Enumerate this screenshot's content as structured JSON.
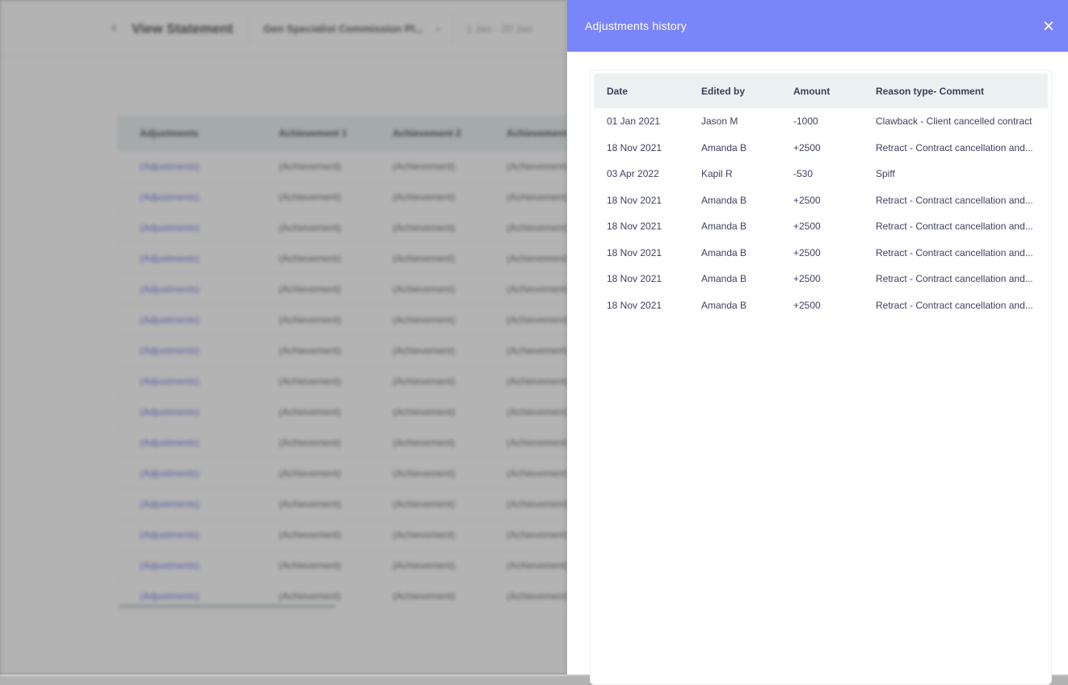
{
  "background_page": {
    "back_icon": "chevron-left-icon",
    "title": "View Statement",
    "plan_select": "Gen Specialist Commission Pl...",
    "plan_chevron_icon": "chevron-down-icon",
    "date_range": "1 Jan - 20 Jan",
    "table": {
      "columns": [
        "Adjustments",
        "Achievement 1",
        "Achievement 2",
        "Achievement"
      ],
      "rows": [
        [
          "(Adjustments)",
          "(Achievement)",
          "(Achievement)",
          "(Achievement)"
        ],
        [
          "(Adjustments)",
          "(Achievement)",
          "(Achievement)",
          "(Achievement)"
        ],
        [
          "(Adjustments)",
          "(Achievement)",
          "(Achievement)",
          "(Achievement)"
        ],
        [
          "(Adjustments)",
          "(Achievement)",
          "(Achievement)",
          "(Achievement)"
        ],
        [
          "(Adjustments)",
          "(Achievement)",
          "(Achievement)",
          "(Achievement)"
        ],
        [
          "(Adjustments)",
          "(Achievement)",
          "(Achievement)",
          "(Achievement)"
        ],
        [
          "(Adjustments)",
          "(Achievement)",
          "(Achievement)",
          "(Achievement)"
        ],
        [
          "(Adjustments)",
          "(Achievement)",
          "(Achievement)",
          "(Achievement)"
        ],
        [
          "(Adjustments)",
          "(Achievement)",
          "(Achievement)",
          "(Achievement)"
        ],
        [
          "(Adjustments)",
          "(Achievement)",
          "(Achievement)",
          "(Achievement)"
        ],
        [
          "(Adjustments)",
          "(Achievement)",
          "(Achievement)",
          "(Achievement)"
        ],
        [
          "(Adjustments)",
          "(Achievement)",
          "(Achievement)",
          "(Achievement)"
        ],
        [
          "(Adjustments)",
          "(Achievement)",
          "(Achievement)",
          "(Achievement)"
        ],
        [
          "(Adjustments)",
          "(Achievement)",
          "(Achievement)",
          "(Achievement)"
        ],
        [
          "(Adjustments)",
          "(Achievement)",
          "(Achievement)",
          "(Achievement)"
        ]
      ]
    }
  },
  "drawer": {
    "title": "Adjustments history",
    "close_icon": "close-icon",
    "header_color": "#7b85fa",
    "table": {
      "columns": {
        "date": "Date",
        "edited_by": "Edited by",
        "amount": "Amount",
        "reason": "Reason type- Comment"
      },
      "rows": [
        {
          "date": "01 Jan 2021",
          "edited_by": "Jason M",
          "amount": "-1000",
          "reason": "Clawback - Client cancelled contract"
        },
        {
          "date": "18 Nov 2021",
          "edited_by": "Amanda B",
          "amount": "+2500",
          "reason": "Retract - Contract cancellation and..."
        },
        {
          "date": "03 Apr 2022",
          "edited_by": "Kapil R",
          "amount": "-530",
          "reason": "Spiff"
        },
        {
          "date": "18 Nov 2021",
          "edited_by": "Amanda B",
          "amount": "+2500",
          "reason": "Retract - Contract cancellation and..."
        },
        {
          "date": "18 Nov 2021",
          "edited_by": "Amanda B",
          "amount": "+2500",
          "reason": "Retract - Contract cancellation and..."
        },
        {
          "date": "18 Nov 2021",
          "edited_by": "Amanda B",
          "amount": "+2500",
          "reason": "Retract - Contract cancellation and..."
        },
        {
          "date": "18 Nov 2021",
          "edited_by": "Amanda B",
          "amount": "+2500",
          "reason": "Retract - Contract cancellation and..."
        },
        {
          "date": "18 Nov 2021",
          "edited_by": "Amanda B",
          "amount": "+2500",
          "reason": "Retract - Contract cancellation and..."
        }
      ]
    }
  }
}
